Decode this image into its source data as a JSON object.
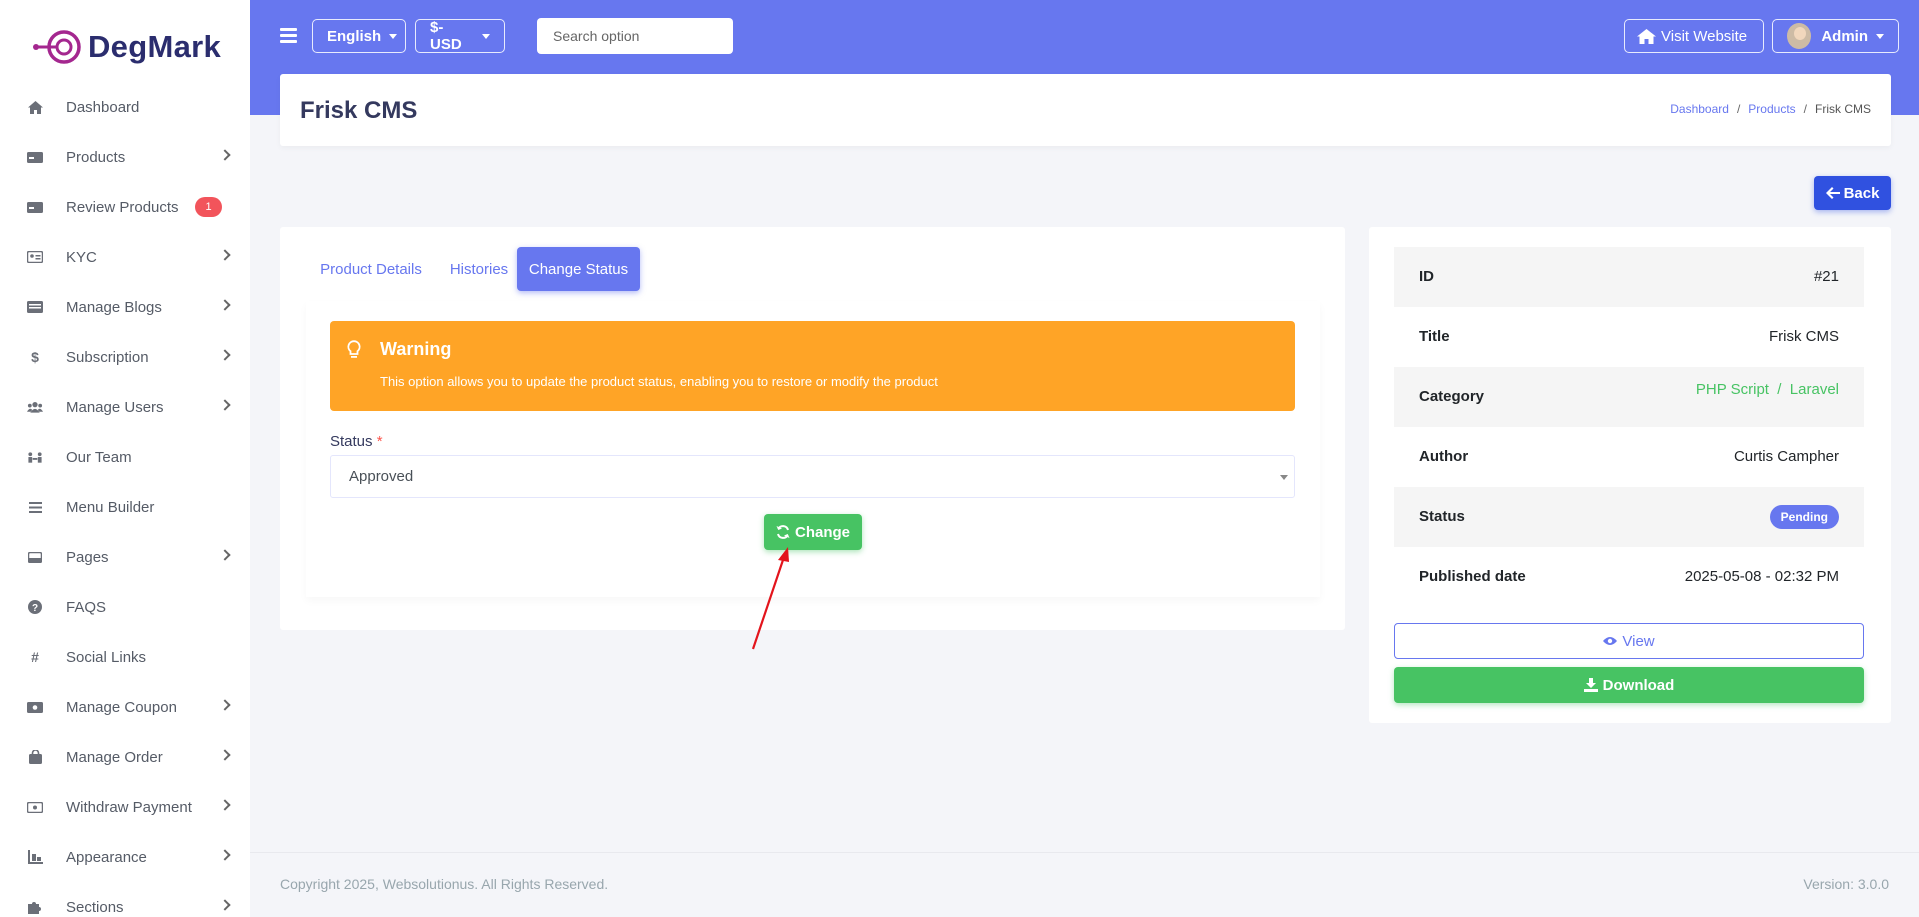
{
  "brand": {
    "name": "DegMark"
  },
  "sidebar": {
    "items": [
      {
        "label": "Dashboard",
        "icon": "home-icon",
        "chevron": false
      },
      {
        "label": "Products",
        "icon": "product-icon",
        "chevron": true
      },
      {
        "label": "Review Products",
        "icon": "review-icon",
        "chevron": false,
        "badge": "1"
      },
      {
        "label": "KYC",
        "icon": "id-card-icon",
        "chevron": true
      },
      {
        "label": "Manage Blogs",
        "icon": "blog-icon",
        "chevron": true
      },
      {
        "label": "Subscription",
        "icon": "dollar-icon",
        "chevron": true
      },
      {
        "label": "Manage Users",
        "icon": "users-icon",
        "chevron": true
      },
      {
        "label": "Our Team",
        "icon": "team-icon",
        "chevron": false
      },
      {
        "label": "Menu Builder",
        "icon": "menu-icon",
        "chevron": false
      },
      {
        "label": "Pages",
        "icon": "pages-icon",
        "chevron": true
      },
      {
        "label": "FAQS",
        "icon": "question-icon",
        "chevron": false
      },
      {
        "label": "Social Links",
        "icon": "hash-icon",
        "chevron": false
      },
      {
        "label": "Manage Coupon",
        "icon": "coupon-icon",
        "chevron": true
      },
      {
        "label": "Manage Order",
        "icon": "bag-icon",
        "chevron": true
      },
      {
        "label": "Withdraw Payment",
        "icon": "wallet-icon",
        "chevron": true
      },
      {
        "label": "Appearance",
        "icon": "appearance-icon",
        "chevron": true
      },
      {
        "label": "Sections",
        "icon": "puzzle-icon",
        "chevron": true
      }
    ]
  },
  "topbar": {
    "language": "English",
    "currency": "$-USD",
    "search_placeholder": "Search option",
    "visit_website": "Visit Website",
    "user": "Admin"
  },
  "page": {
    "title": "Frisk CMS",
    "breadcrumb": [
      "Dashboard",
      "Products",
      "Frisk CMS"
    ],
    "back_label": "Back"
  },
  "tabs": [
    "Product Details",
    "Histories",
    "Change Status"
  ],
  "warning": {
    "title": "Warning",
    "text": "This option allows you to update the product status, enabling you to restore or modify the product"
  },
  "form": {
    "status_label": "Status",
    "required_mark": "*",
    "status_value": "Approved",
    "change_label": "Change"
  },
  "details": {
    "rows": [
      {
        "label": "ID",
        "value": "#21"
      },
      {
        "label": "Title",
        "value": "Frisk CMS"
      },
      {
        "label": "Category",
        "value": "PHP Script  /  Laravel"
      },
      {
        "label": "Author",
        "value": "Curtis Campher"
      },
      {
        "label": "Status",
        "value": "Pending"
      },
      {
        "label": "Published date",
        "value": "2025-05-08 - 02:32 PM"
      }
    ],
    "view_label": "View",
    "download_label": "Download"
  },
  "footer": {
    "copyright": "Copyright 2025, Websolutionus. All Rights Reserved.",
    "version": "Version: 3.0.0"
  },
  "colors": {
    "primary": "#6777ef",
    "success": "#47c363",
    "warning": "#ffa426",
    "danger": "#f2545b",
    "back": "#3051e0"
  }
}
